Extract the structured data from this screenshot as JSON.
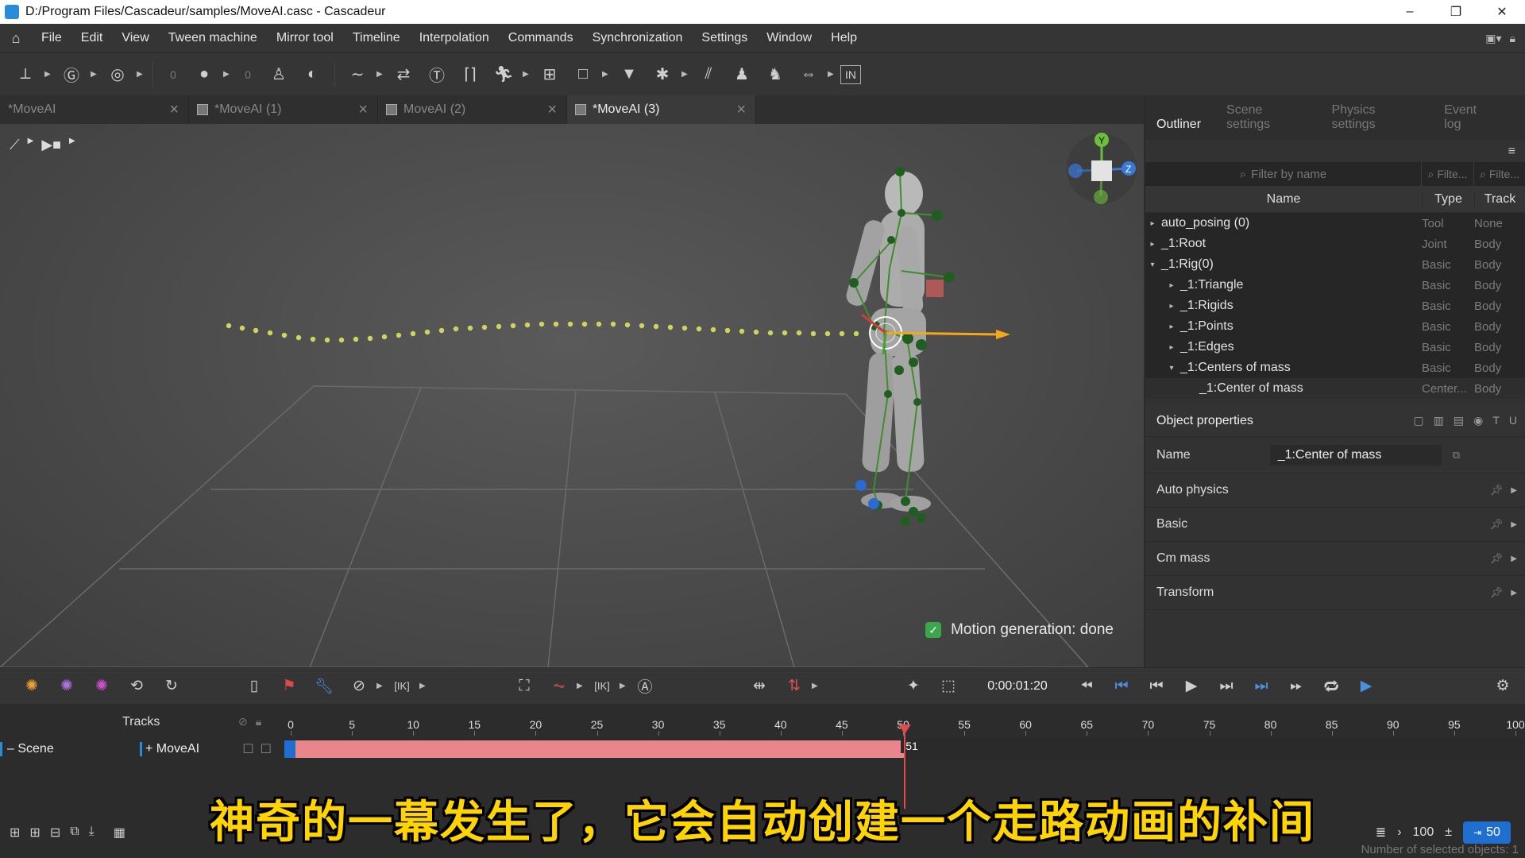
{
  "window": {
    "title": "D:/Program Files/Cascadeur/samples/MoveAI.casc - Cascadeur",
    "minimize": "–",
    "restore": "❐",
    "close": "✕"
  },
  "menu": {
    "items": [
      "File",
      "Edit",
      "View",
      "Tween machine",
      "Mirror tool",
      "Timeline",
      "Interpolation",
      "Commands",
      "Synchronization",
      "Settings",
      "Window",
      "Help"
    ]
  },
  "toolbar": {
    "value_a": "0",
    "value_b": "0",
    "in_label": "IN"
  },
  "tabs": [
    {
      "label": "*MoveAI",
      "active": false
    },
    {
      "label": "*MoveAI (1)",
      "active": false
    },
    {
      "label": "MoveAI (2)",
      "active": false
    },
    {
      "label": "*MoveAI (3)",
      "active": true
    }
  ],
  "viewport": {
    "status_text": "Motion generation: done",
    "gizmo": {
      "y": "Y",
      "z": "Z"
    }
  },
  "right_panel": {
    "tabs": [
      "Outliner",
      "Scene settings",
      "Physics settings",
      "Event log"
    ],
    "filter_placeholder": "Filter by name",
    "filter_type_placeholder": "Filte...",
    "filter_track_placeholder": "Filte...",
    "columns": {
      "name": "Name",
      "type": "Type",
      "track": "Track"
    },
    "rows": [
      {
        "name": "auto_posing (0)",
        "type": "Tool",
        "track": "None",
        "indent": 0,
        "arrow": "▸"
      },
      {
        "name": "_1:Root",
        "type": "Joint",
        "track": "Body",
        "indent": 0,
        "arrow": "▸"
      },
      {
        "name": "_1:Rig(0)",
        "type": "Basic",
        "track": "Body",
        "indent": 0,
        "arrow": "▾"
      },
      {
        "name": "_1:Triangle",
        "type": "Basic",
        "track": "Body",
        "indent": 1,
        "arrow": "▸"
      },
      {
        "name": "_1:Rigids",
        "type": "Basic",
        "track": "Body",
        "indent": 1,
        "arrow": "▸"
      },
      {
        "name": "_1:Points",
        "type": "Basic",
        "track": "Body",
        "indent": 1,
        "arrow": "▸"
      },
      {
        "name": "_1:Edges",
        "type": "Basic",
        "track": "Body",
        "indent": 1,
        "arrow": "▸"
      },
      {
        "name": "_1:Centers of mass",
        "type": "Basic",
        "track": "Body",
        "indent": 1,
        "arrow": "▾"
      },
      {
        "name": "_1:Center of mass",
        "type": "Center...",
        "track": "Body",
        "indent": 2,
        "arrow": ""
      }
    ],
    "object_properties": {
      "title": "Object properties",
      "name_label": "Name",
      "name_value": "_1:Center of mass",
      "sections": [
        "Auto physics",
        "Basic",
        "Cm mass",
        "Transform"
      ]
    }
  },
  "timeline": {
    "time": "0:00:01:20",
    "tracks_label": "Tracks",
    "scene_label": "– Scene",
    "track_label": "+ MoveAI",
    "ruler": [
      0,
      5,
      10,
      15,
      20,
      25,
      30,
      35,
      40,
      45,
      50,
      55,
      60,
      65,
      70,
      75,
      80,
      85,
      90,
      95,
      100
    ],
    "current_frame": "51",
    "bottom_left_value": "0",
    "zoom_value": "100",
    "end_frame": "50",
    "selected_count": "Number of selected objects: 1"
  },
  "subtitle": "神奇的一幕发生了，它会自动创建一个走路动画的补间"
}
